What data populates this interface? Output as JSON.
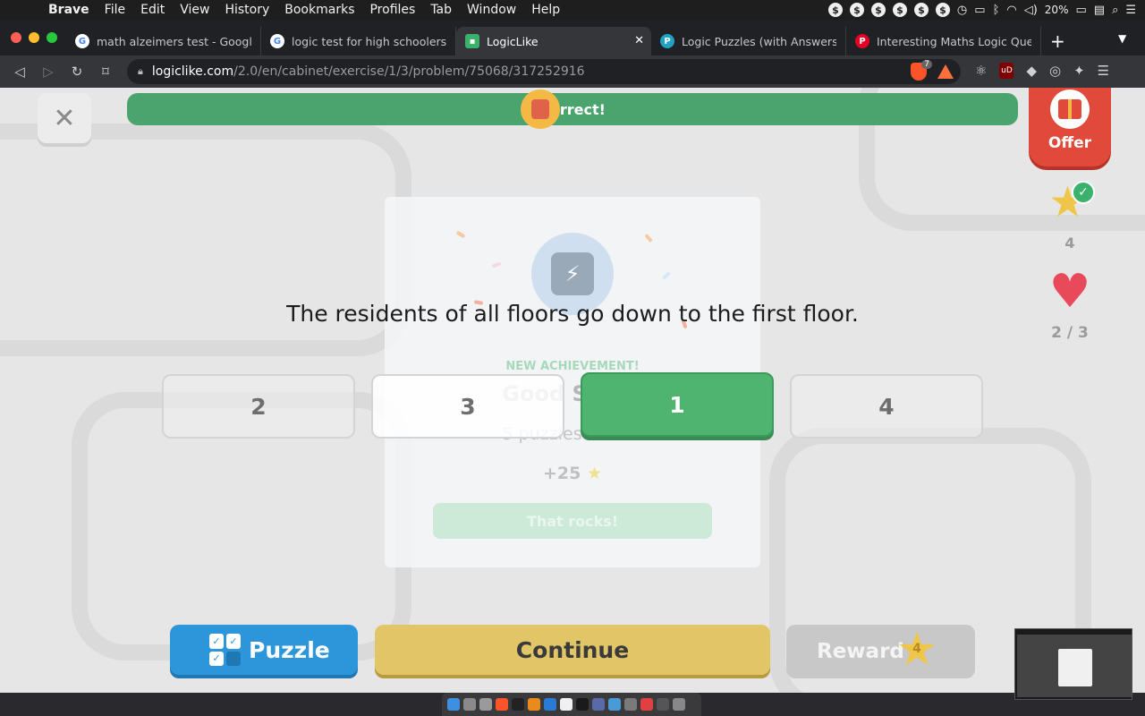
{
  "menubar": {
    "app": "Brave",
    "items": [
      "File",
      "Edit",
      "View",
      "History",
      "Bookmarks",
      "Profiles",
      "Tab",
      "Window",
      "Help"
    ],
    "battery": "20%"
  },
  "tabs": [
    {
      "title": "math alzeimers test - Google Se",
      "icon": "google-icon"
    },
    {
      "title": "logic test for high schoolers fun",
      "icon": "google-icon"
    },
    {
      "title": "LogicLike",
      "icon": "logiclike-icon",
      "active": true
    },
    {
      "title": "Logic Puzzles (with Answers)—",
      "icon": "p-icon"
    },
    {
      "title": "Interesting Maths Logic Questio",
      "icon": "pinterest-icon"
    }
  ],
  "address": {
    "host": "logiclike.com",
    "path": "/2.0/en/cabinet/exercise/1/3/problem/75068/317252916",
    "shield_count": "7"
  },
  "page": {
    "close_label": "✕",
    "feedback": "Correct!",
    "offer": "Offer",
    "stars_count": "4",
    "lives": "2 / 3",
    "question": "The residents of all floors go down to the first floor.",
    "answers": [
      "2",
      "3",
      "1",
      "4"
    ],
    "achievement": {
      "label": "NEW ACHIEVEMENT!",
      "title": "Good Start!",
      "subtitle": "5 puzzles solved",
      "points": "+25",
      "button": "That rocks!"
    },
    "buttons": {
      "puzzle": "Puzzle",
      "continue": "Continue",
      "reward": "Reward",
      "reward_count": "4"
    }
  },
  "colors": {
    "correct_green": "#4ba46d",
    "continue_yellow": "#e2c567",
    "puzzle_blue": "#2d96db",
    "offer_red": "#e14a3b"
  }
}
